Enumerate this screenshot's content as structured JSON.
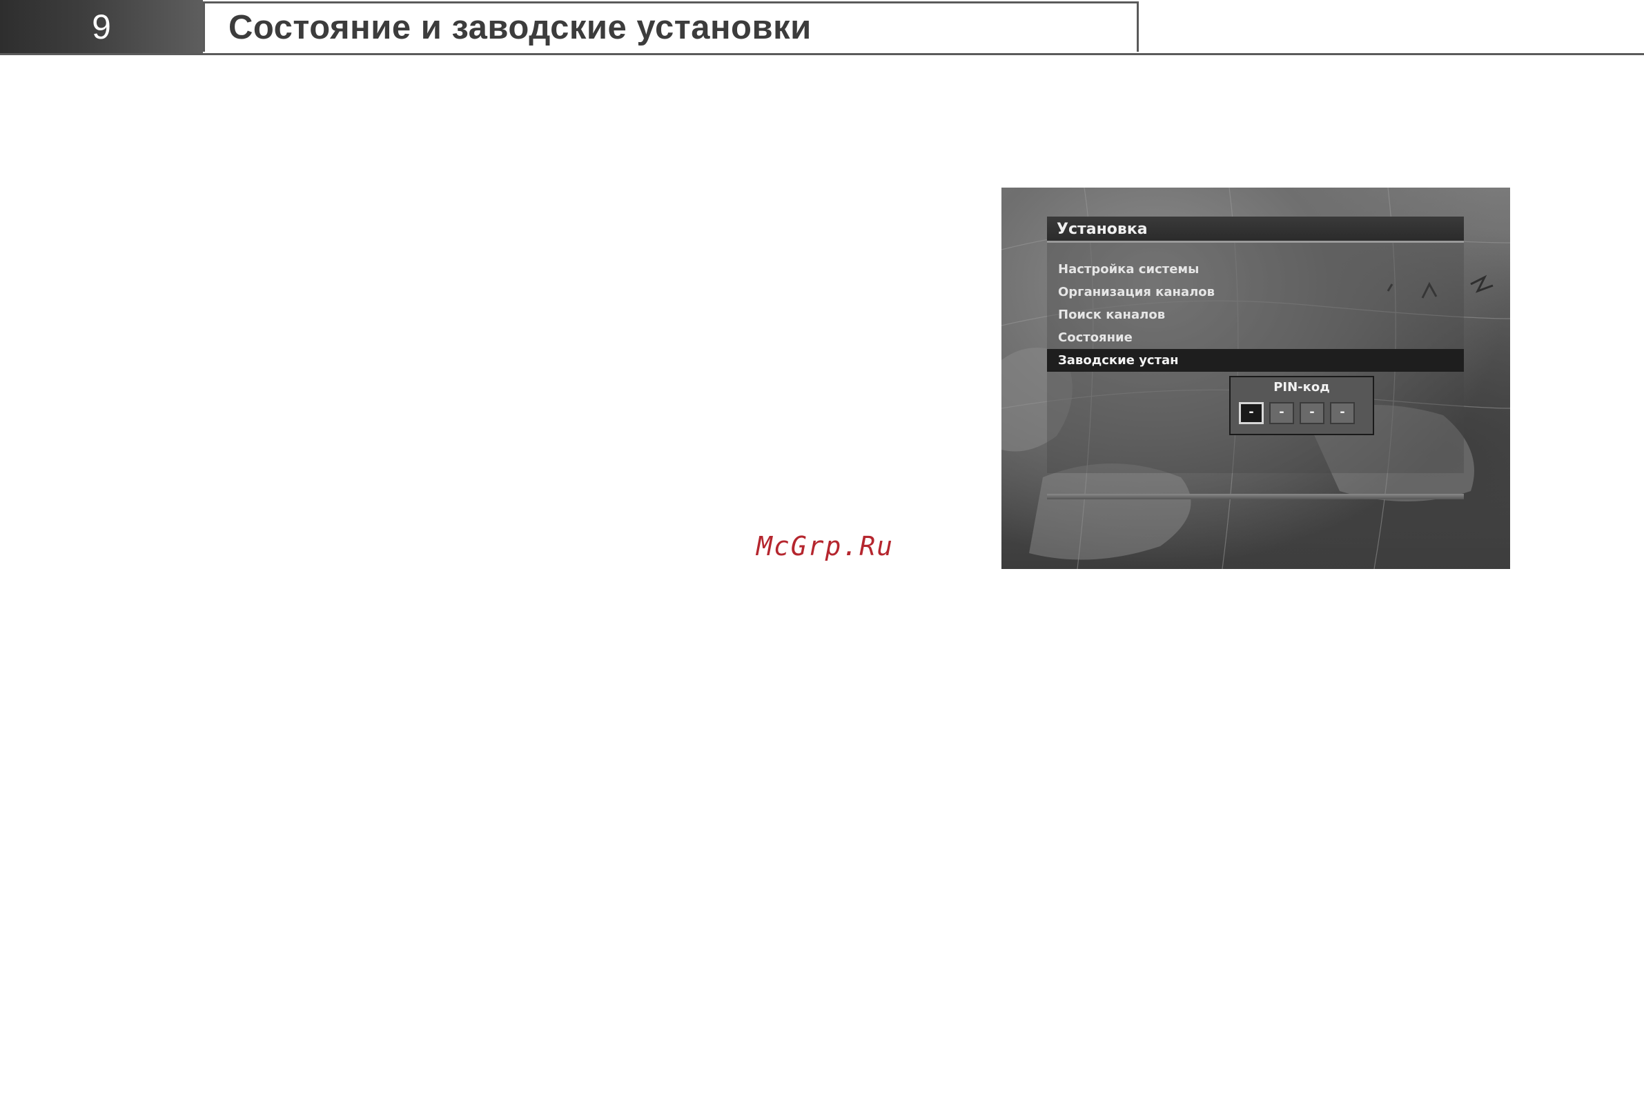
{
  "header": {
    "chapter_number": "9",
    "title": "Состояние и заводские установки"
  },
  "watermark": {
    "text": "McGrp.Ru",
    "color": "#b5262e"
  },
  "screenshot": {
    "menu": {
      "title": "Установка",
      "items": [
        {
          "label": "Настройка системы",
          "selected": false
        },
        {
          "label": "Организация каналов",
          "selected": false
        },
        {
          "label": "Поиск каналов",
          "selected": false
        },
        {
          "label": "Состояние",
          "selected": false
        },
        {
          "label": "Заводские устан",
          "selected": true
        }
      ]
    },
    "pin_dialog": {
      "title": "PIN-код",
      "digits": [
        "-",
        "-",
        "-",
        "-"
      ],
      "active_index": 0
    }
  }
}
